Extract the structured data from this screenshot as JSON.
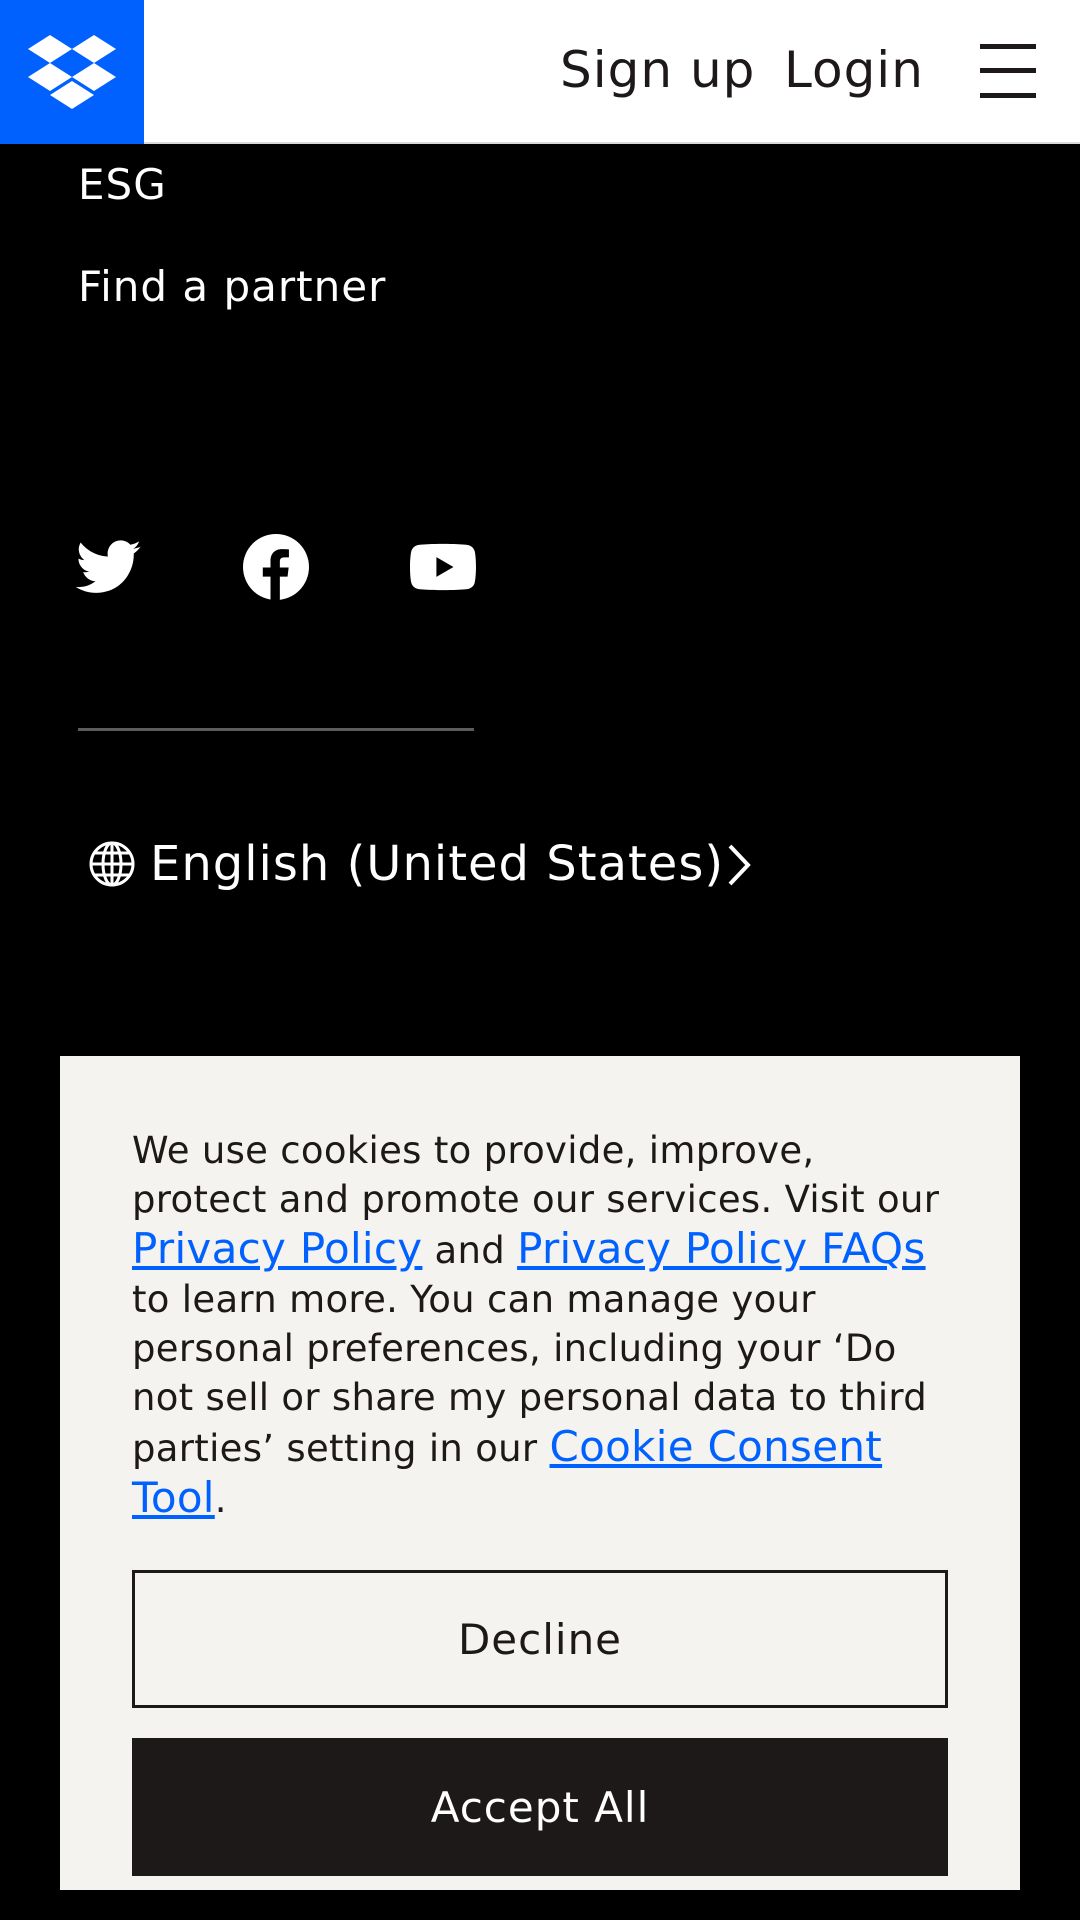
{
  "header": {
    "logo_icon": "dropbox-logo-icon",
    "signup_label": "Sign up",
    "login_label": "Login",
    "menu_icon": "hamburger-menu-icon"
  },
  "footer": {
    "links": [
      "ESG",
      "Find a partner"
    ],
    "social_icons": [
      "twitter-icon",
      "facebook-icon",
      "youtube-icon"
    ],
    "language": {
      "icon": "globe-icon",
      "label": "English (United States)",
      "chevron": "chevron-right-icon"
    }
  },
  "cookie_banner": {
    "text_1": "We use cookies to provide, improve, protect and promote our services. Visit our ",
    "privacy_policy_link": "Privacy Policy",
    "text_2": " and ",
    "privacy_faq_link": "Privacy Policy FAQs",
    "text_3": " to learn more. You can manage your personal preferences, including your ‘Do not sell or share my personal data to third parties’ setting in our ",
    "consent_tool_link": "Cookie Consent Tool",
    "text_4": ".",
    "decline_label": "Decline",
    "accept_label": "Accept All"
  },
  "colors": {
    "brand_blue": "#0061fe",
    "background": "#000000",
    "banner_bg": "#f5f3f0",
    "dark": "#1e1919"
  }
}
